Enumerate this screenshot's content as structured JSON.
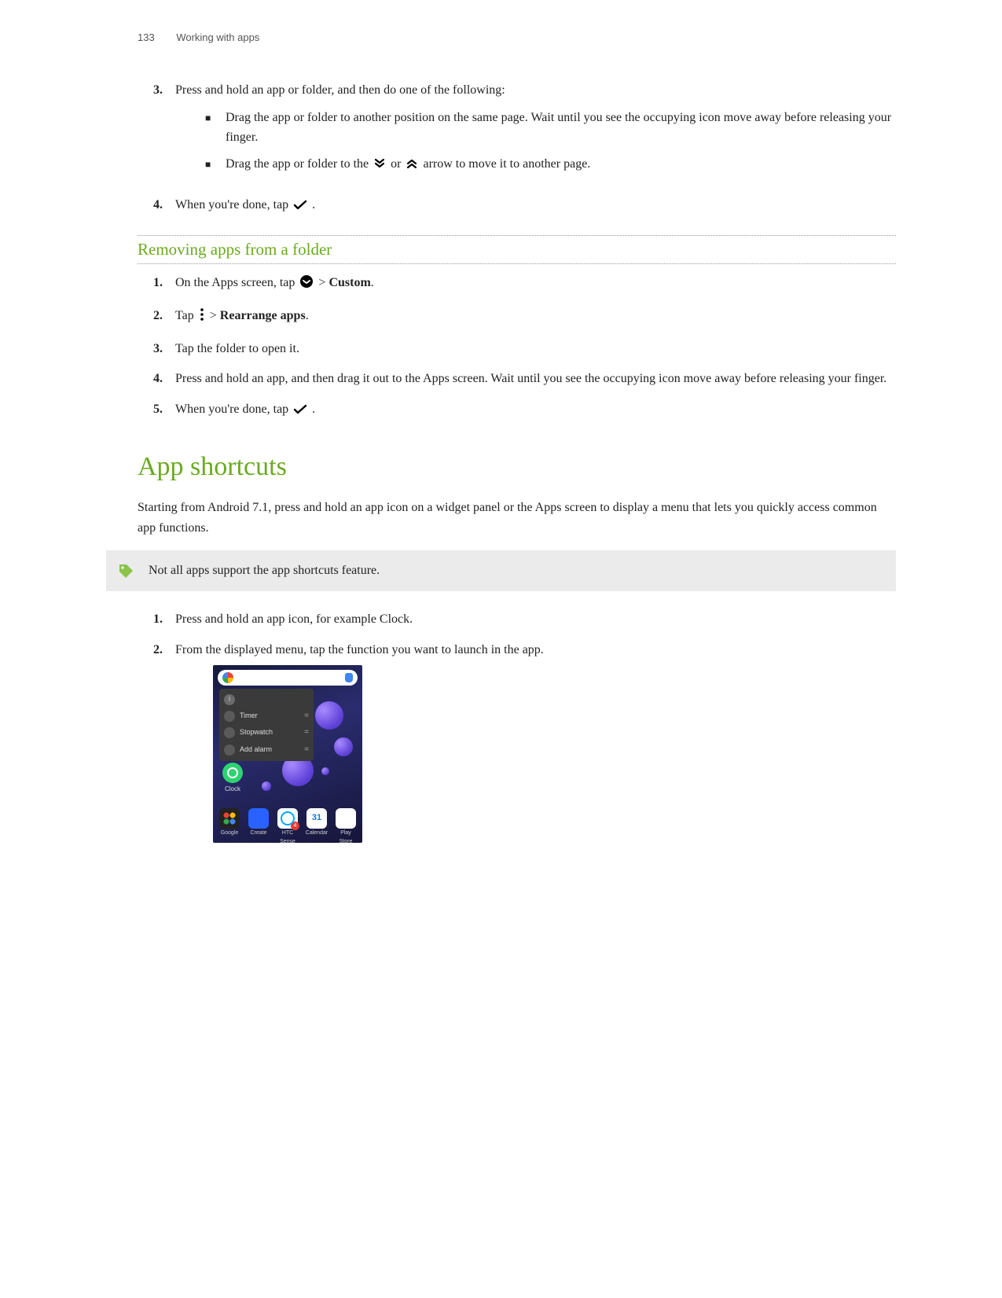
{
  "header": {
    "page_number": "133",
    "section": "Working with apps"
  },
  "top_list": {
    "items": [
      {
        "num": "3.",
        "text": "Press and hold an app or folder, and then do one of the following:",
        "bullets": [
          {
            "text_a": "Drag the app or folder to another position on the same page. Wait until you see the occupying icon move away before releasing your finger."
          },
          {
            "text_a": "Drag the app or folder to the ",
            "text_b": " or ",
            "text_c": " arrow to move it to another page."
          }
        ]
      },
      {
        "num": "4.",
        "text_a": "When you're done, tap ",
        "text_b": "."
      }
    ]
  },
  "removing": {
    "heading": "Removing apps from a folder",
    "items": [
      {
        "num": "1.",
        "text_a": "On the Apps screen, tap ",
        "text_b": " > ",
        "bold_c": "Custom",
        "text_d": "."
      },
      {
        "num": "2.",
        "text_a": "Tap ",
        "text_b": " > ",
        "bold_c": "Rearrange apps",
        "text_d": "."
      },
      {
        "num": "3.",
        "text_a": "Tap the folder to open it."
      },
      {
        "num": "4.",
        "text_a": "Press and hold an app, and then drag it out to the Apps screen. Wait until you see the occupying icon move away before releasing your finger."
      },
      {
        "num": "5.",
        "text_a": "When you're done, tap ",
        "text_b": "."
      }
    ]
  },
  "shortcuts": {
    "heading": "App shortcuts",
    "intro": "Starting from Android 7.1, press and hold an app icon on a widget panel or the Apps screen to display a menu that lets you quickly access common app functions.",
    "note": "Not all apps support the app shortcuts feature.",
    "items": [
      {
        "num": "1.",
        "text": "Press and hold an app icon, for example Clock."
      },
      {
        "num": "2.",
        "text": "From the displayed menu, tap the function you want to launch in the app."
      }
    ]
  },
  "screenshot": {
    "popup": {
      "rows": [
        {
          "label": "Timer"
        },
        {
          "label": "Stopwatch"
        },
        {
          "label": "Add alarm"
        }
      ],
      "more": "="
    },
    "clock_label": "Clock",
    "dock": [
      {
        "label": "Google"
      },
      {
        "label": "Create"
      },
      {
        "label": "HTC Sense Companion",
        "badge": "4"
      },
      {
        "label": "Calendar",
        "day": "31"
      },
      {
        "label": "Play Store"
      }
    ]
  },
  "icons": {
    "checkmark": "checkmark-icon",
    "chevrons_down": "double-chevron-down-icon",
    "chevrons_up": "double-chevron-up-icon",
    "dropdown_circle": "dropdown-circle-icon",
    "more_vert": "more-vertical-icon",
    "tag": "tag-icon"
  }
}
